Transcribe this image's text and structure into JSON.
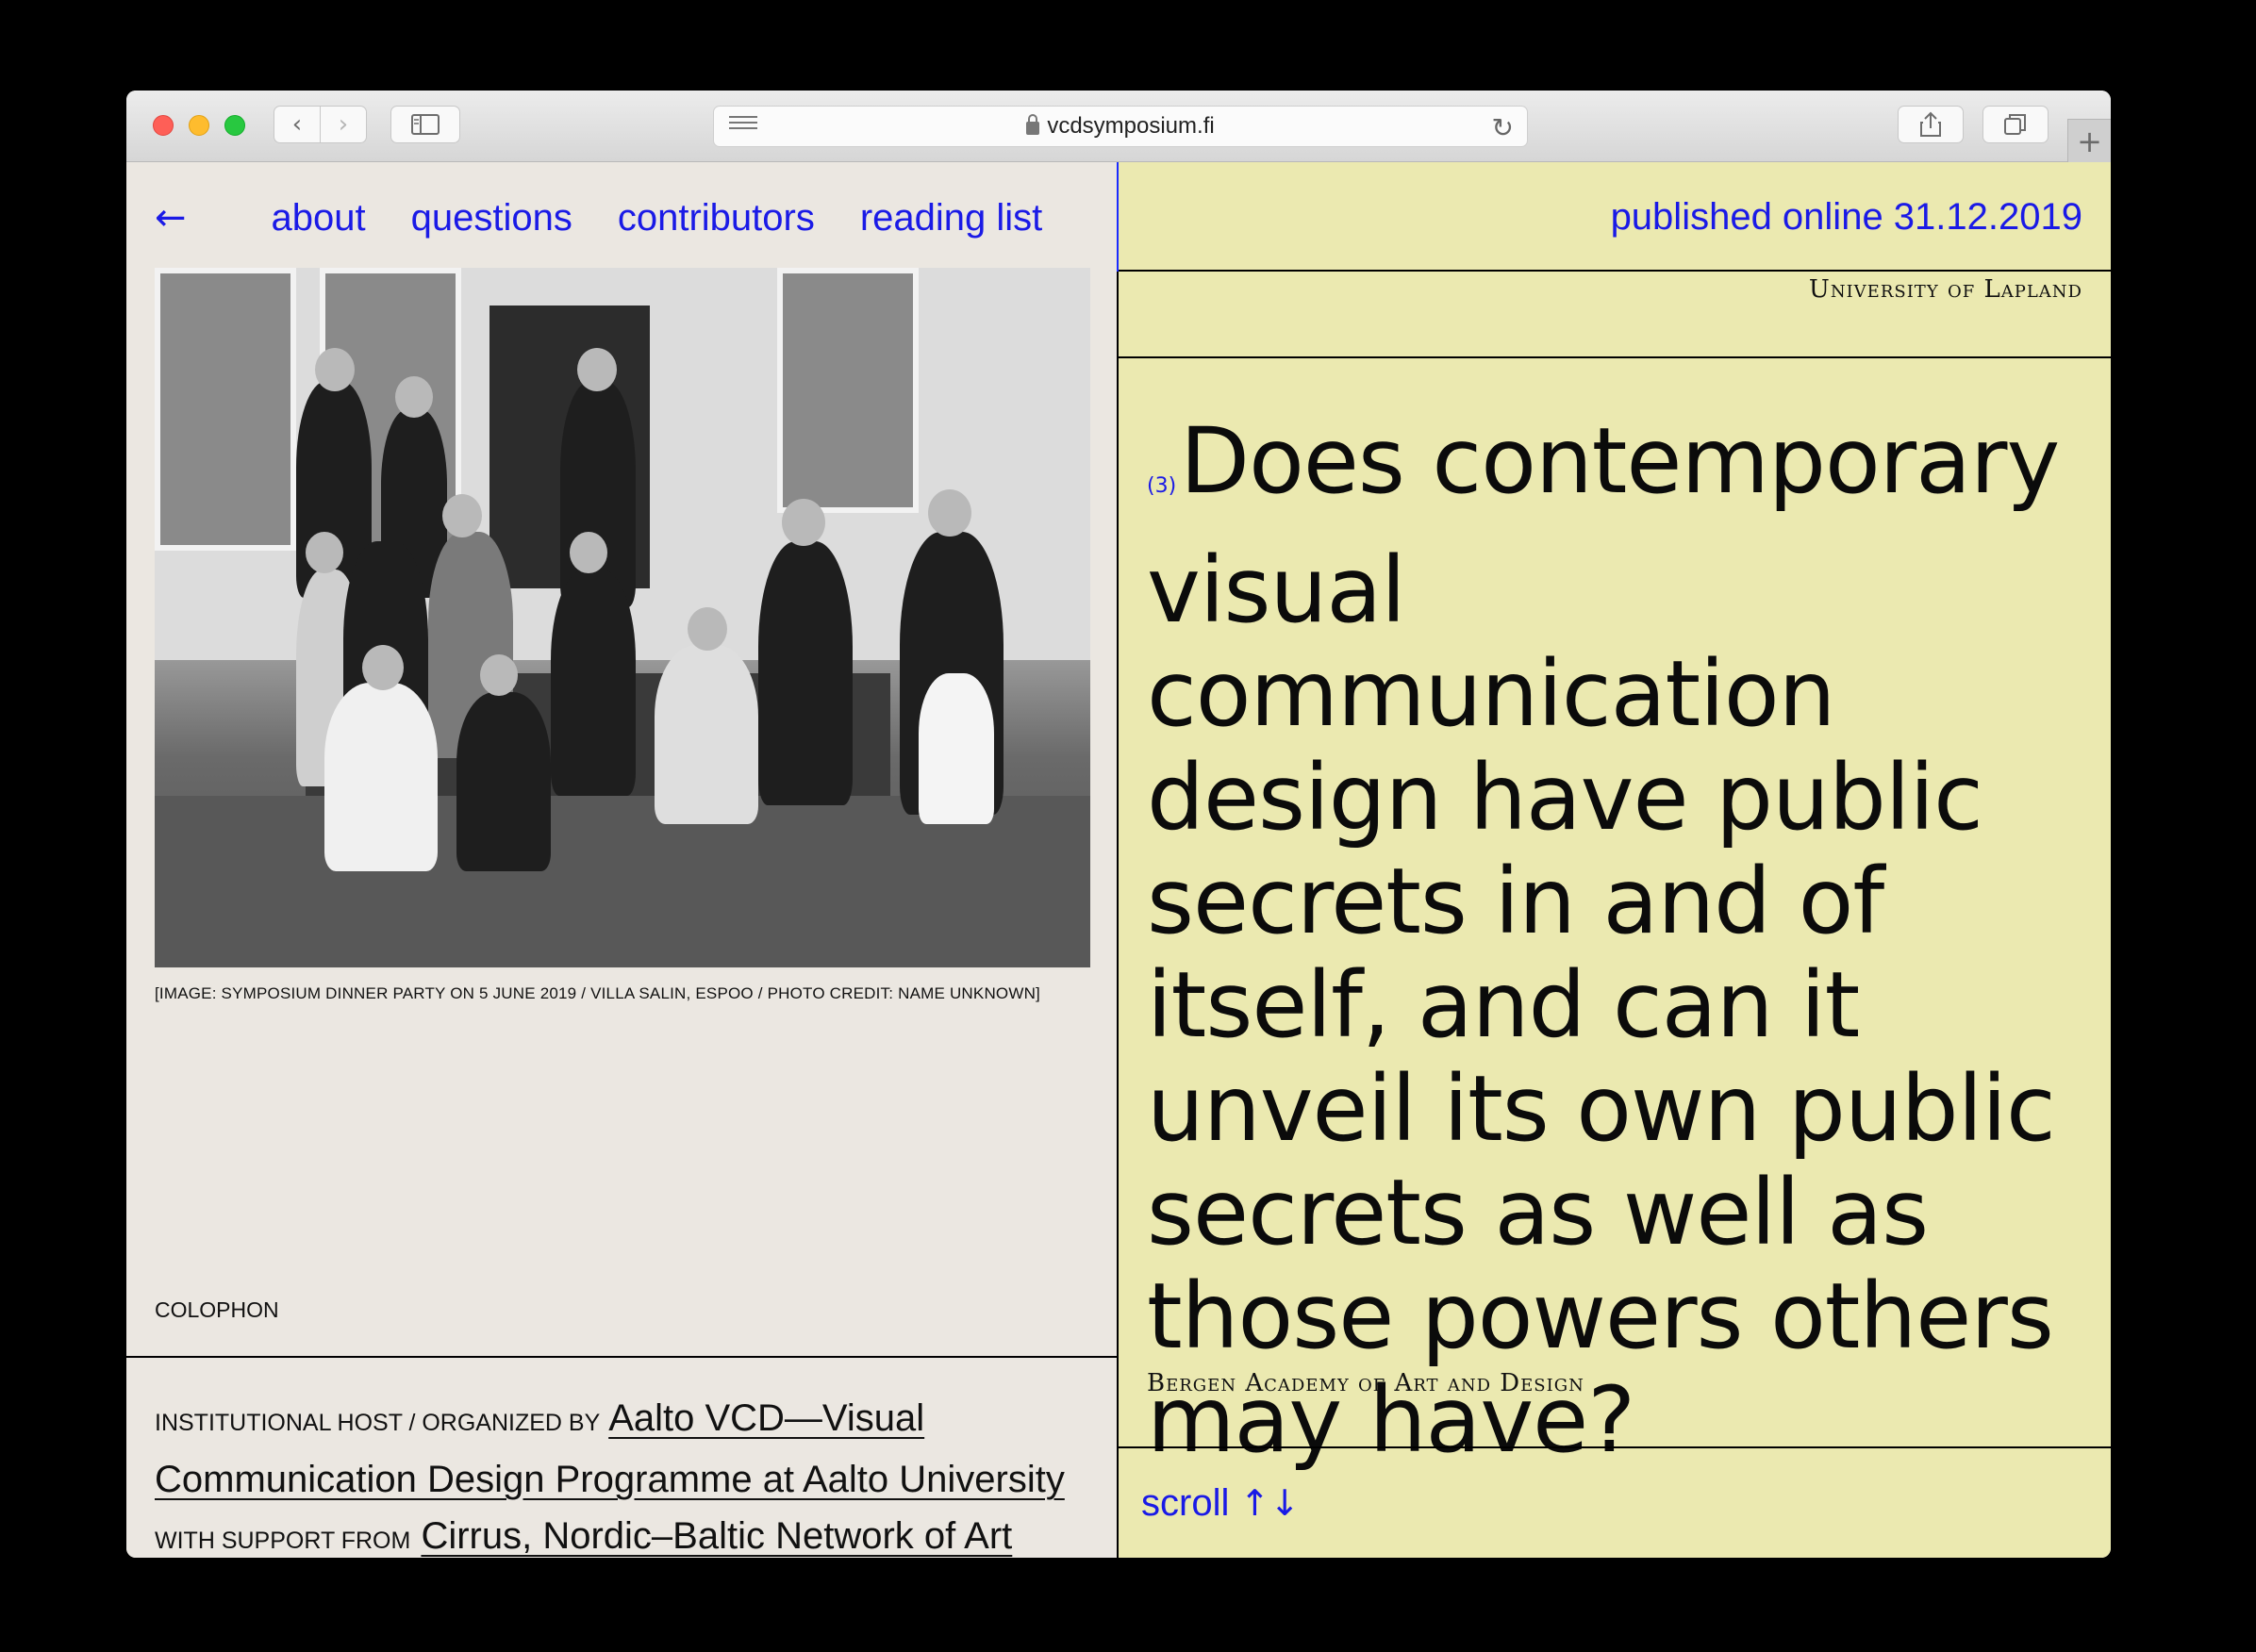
{
  "browser": {
    "url": "vcdsymposium.fi",
    "new_tab": "+"
  },
  "nav": {
    "back": "←",
    "items": [
      "about",
      "questions",
      "contributors",
      "reading list"
    ]
  },
  "left": {
    "image_caption": "[IMAGE: SYMPOSIUM DINNER PARTY ON 5 JUNE 2019 / VILLA SALIN, ESPOO / PHOTO CREDIT: NAME UNKNOWN]",
    "colophon_label": "COLOPHON",
    "colophon": {
      "host_label": "institutional host / organized by",
      "host_link": "Aalto VCD—Visual Communication Design Programme at Aalto University",
      "support_label": "with support from",
      "support_link": "Cirrus, Nordic–Baltic Network of Art and"
    }
  },
  "right": {
    "published": "published online 31.12.2019",
    "university": "University of Lapland",
    "question_number": "(3)",
    "question": "Does contemporary visual communication design have public secrets in and of itself, and can it unveil its own public secrets as well as those powers others may have?",
    "attribution": "Bergen Academy of Art and Design",
    "scroll_label": "scroll",
    "scroll_arrows": "↑↓"
  }
}
